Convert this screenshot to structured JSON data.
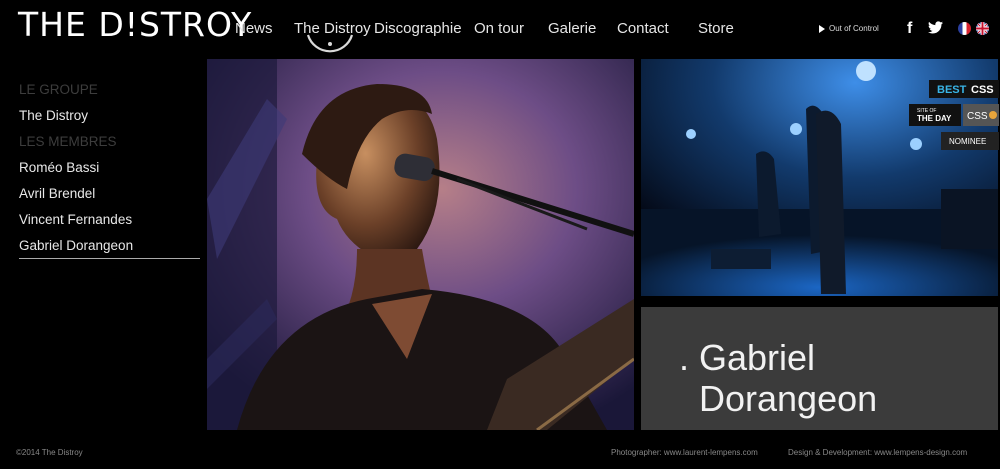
{
  "brand": {
    "logo": "THE D!STROY"
  },
  "nav": {
    "items": [
      {
        "label": "News"
      },
      {
        "label": "The Distroy"
      },
      {
        "label": "Discographie"
      },
      {
        "label": "On tour"
      },
      {
        "label": "Galerie"
      },
      {
        "label": "Contact"
      },
      {
        "label": "Store"
      }
    ],
    "active_index": 1
  },
  "audio": {
    "track": "Out of Control"
  },
  "social": {
    "facebook": "f",
    "twitter": "twitter-icon"
  },
  "languages": [
    {
      "name": "FR"
    },
    {
      "name": "EN"
    }
  ],
  "sidebar": {
    "group_heading": "LE GROUPE",
    "group_items": [
      {
        "label": "The Distroy"
      }
    ],
    "members_heading": "LES MEMBRES",
    "members": [
      {
        "label": "Roméo Bassi"
      },
      {
        "label": "Avril Brendel"
      },
      {
        "label": "Vincent Fernandes"
      },
      {
        "label": "Gabriel Dorangeon"
      }
    ],
    "active_member_index": 3
  },
  "badge": {
    "line1_best": "BEST",
    "line1_css": "CSS",
    "site_of": "SITE OF",
    "the_day": "THE DAY",
    "css": "CSS",
    "nominee": "NOMINEE"
  },
  "profile": {
    "prefix": ".",
    "first_name": "Gabriel",
    "last_name": "Dorangeon"
  },
  "footer": {
    "copyright": "©2014 The Distroy",
    "photographer": "Photographer: www.laurent-lempens.com",
    "design": "Design & Development: www.lempens-design.com"
  },
  "colors": {
    "background": "#000000",
    "panel": "#3b3b3b",
    "stage_blue": "#1f6fd1",
    "badge_blue": "#39b4e6"
  }
}
